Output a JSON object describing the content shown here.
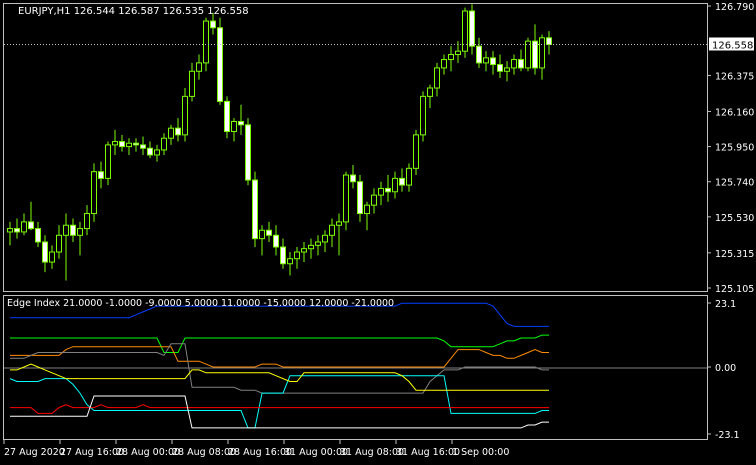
{
  "colors": {
    "background": "#000000",
    "frame": "#c0c0c0",
    "text": "#ffffff",
    "candle": "#7cfc00",
    "candle_up_fill": "#000000",
    "candle_down_fill": "#ffffff",
    "price_line": "#c0c0c0",
    "label_bg": "#ffffff",
    "label_text": "#000000",
    "series": [
      "#0040ff",
      "#00ff00",
      "#ff8c00",
      "#808080",
      "#00ffff",
      "#ffff00",
      "#ff0000",
      "#ffffff"
    ]
  },
  "main_chart": {
    "header": "EURJPY,H1  126.544 126.587 126.535 126.558",
    "current_price": "126.558",
    "y_ticks": [
      "126.790",
      "126.375",
      "126.160",
      "125.950",
      "125.740",
      "125.530",
      "125.315",
      "125.105"
    ],
    "y_ticks_num": [
      126.79,
      126.375,
      126.16,
      125.95,
      125.74,
      125.53,
      125.315,
      125.105
    ],
    "y_range": [
      125.105,
      126.79
    ],
    "candles": [
      [
        125.44,
        125.5,
        125.36,
        125.46
      ],
      [
        125.46,
        125.52,
        125.4,
        125.44
      ],
      [
        125.44,
        125.55,
        125.42,
        125.5
      ],
      [
        125.5,
        125.62,
        125.45,
        125.46
      ],
      [
        125.46,
        125.5,
        125.35,
        125.38
      ],
      [
        125.38,
        125.42,
        125.2,
        125.26
      ],
      [
        125.26,
        125.36,
        125.22,
        125.32
      ],
      [
        125.32,
        125.48,
        125.28,
        125.42
      ],
      [
        125.42,
        125.55,
        125.15,
        125.48
      ],
      [
        125.48,
        125.52,
        125.38,
        125.42
      ],
      [
        125.42,
        125.5,
        125.3,
        125.46
      ],
      [
        125.46,
        125.6,
        125.42,
        125.55
      ],
      [
        125.55,
        125.85,
        125.5,
        125.8
      ],
      [
        125.8,
        125.86,
        125.7,
        125.76
      ],
      [
        125.76,
        125.98,
        125.72,
        125.96
      ],
      [
        125.96,
        126.05,
        125.9,
        125.98
      ],
      [
        125.98,
        126.02,
        125.92,
        125.95
      ],
      [
        125.95,
        126.0,
        125.9,
        125.97
      ],
      [
        125.97,
        126.0,
        125.92,
        125.96
      ],
      [
        125.96,
        126.01,
        125.9,
        125.94
      ],
      [
        125.94,
        125.98,
        125.88,
        125.9
      ],
      [
        125.9,
        125.96,
        125.86,
        125.93
      ],
      [
        125.93,
        126.03,
        125.9,
        126.0
      ],
      [
        126.0,
        126.08,
        125.96,
        126.06
      ],
      [
        126.06,
        126.12,
        125.98,
        126.02
      ],
      [
        126.02,
        126.3,
        125.98,
        126.25
      ],
      [
        126.25,
        126.45,
        126.22,
        126.4
      ],
      [
        126.4,
        126.5,
        126.35,
        126.45
      ],
      [
        126.45,
        126.72,
        126.4,
        126.7
      ],
      [
        126.7,
        126.75,
        126.62,
        126.66
      ],
      [
        126.66,
        126.72,
        126.2,
        126.22
      ],
      [
        126.22,
        126.25,
        126.0,
        126.04
      ],
      [
        126.04,
        126.12,
        125.98,
        126.1
      ],
      [
        126.1,
        126.2,
        126.02,
        126.08
      ],
      [
        126.08,
        126.12,
        125.72,
        125.75
      ],
      [
        125.75,
        125.8,
        125.35,
        125.4
      ],
      [
        125.4,
        125.48,
        125.3,
        125.45
      ],
      [
        125.45,
        125.5,
        125.38,
        125.42
      ],
      [
        125.42,
        125.48,
        125.3,
        125.35
      ],
      [
        125.35,
        125.4,
        125.22,
        125.25
      ],
      [
        125.25,
        125.32,
        125.18,
        125.28
      ],
      [
        125.28,
        125.35,
        125.22,
        125.32
      ],
      [
        125.32,
        125.38,
        125.26,
        125.34
      ],
      [
        125.34,
        125.4,
        125.28,
        125.36
      ],
      [
        125.36,
        125.42,
        125.3,
        125.38
      ],
      [
        125.38,
        125.45,
        125.32,
        125.42
      ],
      [
        125.42,
        125.52,
        125.35,
        125.48
      ],
      [
        125.48,
        125.55,
        125.3,
        125.5
      ],
      [
        125.5,
        125.8,
        125.45,
        125.78
      ],
      [
        125.78,
        125.84,
        125.7,
        125.74
      ],
      [
        125.74,
        125.78,
        125.5,
        125.55
      ],
      [
        125.55,
        125.62,
        125.45,
        125.6
      ],
      [
        125.6,
        125.7,
        125.55,
        125.66
      ],
      [
        125.66,
        125.74,
        125.6,
        125.7
      ],
      [
        125.7,
        125.78,
        125.62,
        125.68
      ],
      [
        125.68,
        125.8,
        125.64,
        125.76
      ],
      [
        125.76,
        125.82,
        125.68,
        125.72
      ],
      [
        125.72,
        125.85,
        125.68,
        125.82
      ],
      [
        125.82,
        126.05,
        125.78,
        126.02
      ],
      [
        126.02,
        126.28,
        125.98,
        126.25
      ],
      [
        126.25,
        126.32,
        126.18,
        126.3
      ],
      [
        126.3,
        126.45,
        126.25,
        126.42
      ],
      [
        126.42,
        126.5,
        126.38,
        126.47
      ],
      [
        126.47,
        126.55,
        126.4,
        126.5
      ],
      [
        126.5,
        126.58,
        126.45,
        126.52
      ],
      [
        126.52,
        126.78,
        126.48,
        126.76
      ],
      [
        126.76,
        126.8,
        126.5,
        126.55
      ],
      [
        126.55,
        126.6,
        126.42,
        126.45
      ],
      [
        126.45,
        126.52,
        126.4,
        126.48
      ],
      [
        126.48,
        126.52,
        126.38,
        126.44
      ],
      [
        126.44,
        126.5,
        126.36,
        126.4
      ],
      [
        126.4,
        126.46,
        126.34,
        126.42
      ],
      [
        126.42,
        126.5,
        126.38,
        126.47
      ],
      [
        126.47,
        126.53,
        126.4,
        126.42
      ],
      [
        126.42,
        126.6,
        126.4,
        126.58
      ],
      [
        126.58,
        126.68,
        126.38,
        126.42
      ],
      [
        126.42,
        126.62,
        126.35,
        126.6
      ],
      [
        126.6,
        126.64,
        126.5,
        126.56
      ]
    ]
  },
  "indicator": {
    "label": "Edge Index 21.0000 -1.0000 -9.0000 5.0000 11.0000 -15.0000 12.0000 -21.0000",
    "y_ticks": [
      "23.1",
      "0.00",
      "-23.1"
    ],
    "y_ticks_num": [
      23.1,
      0,
      -23.1
    ],
    "y_range": [
      -23.1,
      23.1
    ],
    "series": [
      [
        17,
        17,
        17,
        17,
        17,
        17,
        17,
        17,
        17,
        17,
        17,
        17,
        17,
        17,
        17,
        17,
        17,
        17,
        18,
        19,
        20,
        21,
        21,
        21,
        21,
        21,
        21,
        21,
        21,
        21,
        21,
        21,
        21,
        21,
        21,
        21,
        21,
        21,
        21,
        21,
        21,
        21,
        21,
        21,
        21,
        21,
        21,
        21,
        21,
        21,
        21,
        21,
        21,
        21,
        21,
        21,
        22,
        22,
        22,
        22,
        22,
        22,
        22,
        22,
        22,
        22,
        22,
        22,
        22,
        21,
        18,
        15,
        14,
        14,
        14,
        14,
        14,
        14
      ],
      [
        10,
        10,
        10,
        10,
        10,
        10,
        10,
        10,
        10,
        10,
        10,
        10,
        10,
        10,
        10,
        10,
        10,
        10,
        10,
        10,
        10,
        10,
        5,
        5,
        5,
        10,
        10,
        10,
        10,
        10,
        10,
        10,
        10,
        10,
        10,
        10,
        10,
        10,
        10,
        10,
        10,
        10,
        10,
        10,
        10,
        10,
        10,
        10,
        10,
        10,
        10,
        10,
        10,
        10,
        10,
        10,
        10,
        10,
        10,
        10,
        10,
        10,
        9,
        7,
        7,
        7,
        7,
        7,
        7,
        7,
        8,
        9,
        9,
        10,
        10,
        10,
        11,
        11
      ],
      [
        4,
        4,
        4,
        4,
        4,
        4,
        4,
        4,
        6,
        7,
        7,
        7,
        7,
        7,
        7,
        7,
        7,
        7,
        7,
        7,
        7,
        7,
        7,
        7,
        2,
        2,
        2,
        2,
        1,
        0,
        0,
        0,
        0,
        0,
        0,
        0,
        1,
        1,
        1,
        0,
        0,
        0,
        0,
        0,
        0,
        0,
        0,
        0,
        0,
        0,
        0,
        0,
        0,
        0,
        0,
        0,
        0,
        0,
        0,
        0,
        0,
        0,
        0,
        3,
        6,
        6,
        6,
        6,
        5,
        4,
        4,
        3,
        3,
        4,
        5,
        6,
        5,
        5
      ],
      [
        3,
        3,
        3,
        4,
        5,
        5,
        5,
        5,
        5,
        5,
        5,
        5,
        5,
        5,
        5,
        5,
        5,
        5,
        5,
        5,
        5,
        5,
        4,
        8,
        8,
        8,
        -7,
        -7,
        -7,
        -7,
        -7,
        -7,
        -7,
        -8,
        -8,
        -8,
        -9,
        -9,
        -9,
        -9,
        -9,
        -9,
        -9,
        -9,
        -9,
        -9,
        -9,
        -9,
        -9,
        -9,
        -9,
        -9,
        -9,
        -9,
        -9,
        -9,
        -9,
        -9,
        -9,
        -9,
        -5,
        -3,
        -1,
        -1,
        -1,
        0,
        0,
        0,
        0,
        0,
        0,
        0,
        0,
        0,
        0,
        0,
        -1,
        -1
      ],
      [
        -4,
        -5,
        -5,
        -5,
        -5,
        -4,
        -4,
        -4,
        -4,
        -6,
        -9,
        -13,
        -15,
        -15,
        -15,
        -15,
        -15,
        -15,
        -15,
        -15,
        -15,
        -15,
        -15,
        -15,
        -15,
        -15,
        -15,
        -15,
        -15,
        -15,
        -15,
        -15,
        -15,
        -15,
        -21,
        -21,
        -9,
        -9,
        -9,
        -9,
        -3,
        -3,
        -3,
        -3,
        -3,
        -3,
        -3,
        -3,
        -3,
        -3,
        -3,
        -3,
        -3,
        -3,
        -3,
        -3,
        -3,
        -3,
        -3,
        -3,
        -3,
        -3,
        -3,
        -16,
        -16,
        -16,
        -16,
        -16,
        -16,
        -16,
        -16,
        -16,
        -16,
        -16,
        -16,
        -16,
        -15,
        -15
      ],
      [
        -1,
        -1,
        0,
        1,
        0,
        -1,
        -2,
        -3,
        -4,
        -4,
        -4,
        -4,
        -4,
        -4,
        -4,
        -4,
        -4,
        -4,
        -4,
        -4,
        -4,
        -4,
        -4,
        -4,
        -4,
        -4,
        -1,
        -1,
        -2,
        -2,
        -2,
        -2,
        -2,
        -2,
        -2,
        -2,
        -2,
        -2,
        -3,
        -4,
        -5,
        -5,
        -2,
        -2,
        -2,
        -2,
        -2,
        -2,
        -2,
        -2,
        -2,
        -2,
        -2,
        -2,
        -2,
        -2,
        -3,
        -5,
        -8,
        -8,
        -8,
        -8,
        -8,
        -8,
        -8,
        -8,
        -8,
        -8,
        -8,
        -8,
        -8,
        -8,
        -8,
        -8,
        -8,
        -8,
        -8,
        -8
      ],
      [
        -14,
        -14,
        -14,
        -14,
        -16,
        -16,
        -16,
        -14,
        -13,
        -14,
        -14,
        -14,
        -14,
        -13,
        -14,
        -14,
        -14,
        -14,
        -14,
        -13,
        -14,
        -14,
        -14,
        -14,
        -14,
        -14,
        -14,
        -14,
        -14,
        -14,
        -14,
        -14,
        -14,
        -14,
        -14,
        -14,
        -14,
        -14,
        -14,
        -14,
        -14,
        -14,
        -14,
        -14,
        -14,
        -14,
        -14,
        -14,
        -14,
        -14,
        -14,
        -14,
        -14,
        -14,
        -14,
        -14,
        -14,
        -14,
        -14,
        -14,
        -14,
        -14,
        -14,
        -14,
        -14,
        -14,
        -14,
        -14,
        -14,
        -14,
        -14,
        -14,
        -14,
        -14,
        -14,
        -14,
        -14,
        -14
      ],
      [
        -17,
        -17,
        -17,
        -17,
        -17,
        -17,
        -17,
        -17,
        -17,
        -17,
        -17,
        -17,
        -10,
        -10,
        -10,
        -10,
        -10,
        -10,
        -10,
        -10,
        -10,
        -10,
        -10,
        -10,
        -10,
        -10,
        -21,
        -21,
        -21,
        -21,
        -21,
        -21,
        -21,
        -21,
        -21,
        -21,
        -21,
        -21,
        -21,
        -21,
        -21,
        -21,
        -21,
        -21,
        -21,
        -21,
        -21,
        -21,
        -21,
        -21,
        -21,
        -21,
        -21,
        -21,
        -21,
        -21,
        -21,
        -21,
        -21,
        -21,
        -21,
        -21,
        -21,
        -21,
        -21,
        -21,
        -21,
        -21,
        -21,
        -21,
        -21,
        -21,
        -21,
        -21,
        -20,
        -20,
        -19,
        -19
      ]
    ]
  },
  "time_axis": {
    "labels": [
      "27 Aug 2020",
      "27 Aug 16:00",
      "28 Aug 00:00",
      "28 Aug 08:00",
      "28 Aug 16:00",
      "31 Aug 00:00",
      "31 Aug 08:00",
      "31 Aug 16:00",
      "1 Sep 00:00"
    ]
  }
}
